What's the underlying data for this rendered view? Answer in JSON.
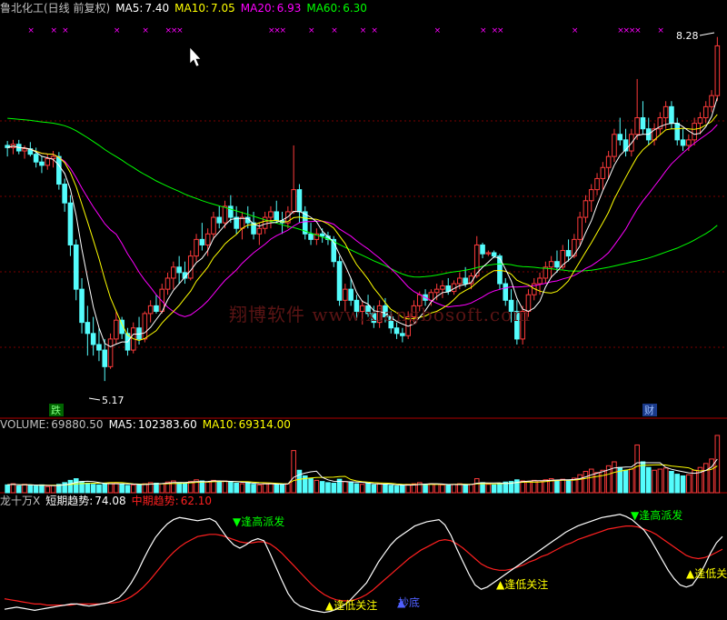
{
  "colors": {
    "up": "#ff3b3b",
    "down": "#54fcfc",
    "ma5": "#ffffff",
    "ma10": "#ffff00",
    "ma20": "#ff00ff",
    "ma60": "#00ff00",
    "grid": "#7a0000",
    "signal_x": "#ff00ff",
    "short_trend": "#ffffff",
    "mid_trend": "#ff2020",
    "label_yellow": "#ffff00",
    "label_green": "#00ff00",
    "label_blue": "#4040ff",
    "sell_box": "#00b000",
    "buy_box": "#3030d0"
  },
  "price_panel": {
    "title": "鲁北化工(日线 前复权)",
    "ma5_label": "MA5:",
    "ma5_value": "7.40",
    "ma10_label": "MA10:",
    "ma10_value": "7.05",
    "ma20_label": "MA20:",
    "ma20_value": "6.93",
    "ma60_label": "MA60:",
    "ma60_value": "6.30",
    "high_label": "8.28",
    "low_label": "5.17",
    "marker_die": "跌",
    "marker_cai": "财",
    "watermark": "翔博软件 www.xiangbosoft.com"
  },
  "volume_panel": {
    "title": "VOLUME:",
    "title_value": "69880.50",
    "ma5_label": "MA5:",
    "ma5_value": "102383.60",
    "ma10_label": "MA10:",
    "ma10_value": "69314.00"
  },
  "indicator_panel": {
    "title": "龙十万X",
    "short_label": "短期趋势:",
    "short_value": "74.08",
    "mid_label": "中期趋势:",
    "mid_value": "62.10",
    "sig_high1": "▼逢高派发",
    "sig_high2": "▼逢高派发",
    "sig_low1": "▲逢低关注",
    "sig_low2": "▲逢低关注",
    "sig_low3": "▲逢低关",
    "sig_buy": "抄底"
  },
  "chart_data": [
    {
      "type": "candlestick",
      "ylim": [
        4.9,
        8.45
      ],
      "candles_ohlc": [
        [
          7.3,
          7.34,
          7.2,
          7.28
        ],
        [
          7.28,
          7.35,
          7.22,
          7.31
        ],
        [
          7.31,
          7.35,
          7.22,
          7.25
        ],
        [
          7.25,
          7.3,
          7.18,
          7.27
        ],
        [
          7.27,
          7.33,
          7.2,
          7.22
        ],
        [
          7.22,
          7.28,
          7.1,
          7.15
        ],
        [
          7.15,
          7.2,
          7.05,
          7.12
        ],
        [
          7.12,
          7.22,
          7.08,
          7.18
        ],
        [
          7.18,
          7.25,
          7.1,
          7.2
        ],
        [
          7.2,
          7.24,
          6.9,
          6.95
        ],
        [
          6.95,
          7.0,
          6.7,
          6.78
        ],
        [
          6.78,
          6.85,
          6.3,
          6.4
        ],
        [
          6.4,
          6.45,
          5.9,
          6.0
        ],
        [
          6.0,
          6.1,
          5.6,
          5.7
        ],
        [
          5.7,
          5.85,
          5.4,
          5.6
        ],
        [
          5.6,
          5.75,
          5.4,
          5.5
        ],
        [
          5.5,
          5.65,
          5.35,
          5.45
        ],
        [
          5.45,
          5.55,
          5.17,
          5.3
        ],
        [
          5.3,
          5.6,
          5.28,
          5.55
        ],
        [
          5.55,
          5.8,
          5.5,
          5.72
        ],
        [
          5.72,
          5.75,
          5.55,
          5.6
        ],
        [
          5.6,
          5.65,
          5.4,
          5.45
        ],
        [
          5.45,
          5.7,
          5.42,
          5.65
        ],
        [
          5.65,
          5.75,
          5.5,
          5.55
        ],
        [
          5.55,
          5.8,
          5.52,
          5.78
        ],
        [
          5.78,
          5.9,
          5.7,
          5.85
        ],
        [
          5.85,
          5.95,
          5.78,
          5.8
        ],
        [
          5.8,
          6.05,
          5.78,
          6.0
        ],
        [
          6.0,
          6.15,
          5.95,
          6.1
        ],
        [
          6.1,
          6.25,
          6.0,
          6.2
        ],
        [
          6.2,
          6.3,
          6.05,
          6.15
        ],
        [
          6.15,
          6.25,
          6.05,
          6.1
        ],
        [
          6.1,
          6.35,
          6.08,
          6.3
        ],
        [
          6.3,
          6.5,
          6.25,
          6.45
        ],
        [
          6.45,
          6.6,
          6.35,
          6.4
        ],
        [
          6.4,
          6.55,
          6.3,
          6.5
        ],
        [
          6.5,
          6.7,
          6.45,
          6.65
        ],
        [
          6.65,
          6.75,
          6.55,
          6.6
        ],
        [
          6.6,
          6.8,
          6.55,
          6.75
        ],
        [
          6.75,
          6.85,
          6.6,
          6.65
        ],
        [
          6.65,
          6.75,
          6.5,
          6.55
        ],
        [
          6.55,
          6.7,
          6.45,
          6.65
        ],
        [
          6.65,
          6.75,
          6.55,
          6.6
        ],
        [
          6.6,
          6.7,
          6.45,
          6.5
        ],
        [
          6.5,
          6.6,
          6.4,
          6.55
        ],
        [
          6.55,
          6.7,
          6.5,
          6.65
        ],
        [
          6.65,
          6.75,
          6.55,
          6.7
        ],
        [
          6.7,
          6.8,
          6.6,
          6.62
        ],
        [
          6.62,
          6.7,
          6.5,
          6.6
        ],
        [
          6.6,
          6.75,
          6.55,
          6.7
        ],
        [
          6.7,
          7.3,
          6.68,
          6.9
        ],
        [
          6.9,
          6.95,
          6.6,
          6.7
        ],
        [
          6.7,
          6.75,
          6.45,
          6.5
        ],
        [
          6.5,
          6.6,
          6.4,
          6.45
        ],
        [
          6.45,
          6.55,
          6.4,
          6.5
        ],
        [
          6.5,
          6.55,
          6.42,
          6.48
        ],
        [
          6.48,
          6.52,
          6.4,
          6.45
        ],
        [
          6.45,
          6.48,
          6.2,
          6.25
        ],
        [
          6.25,
          6.3,
          5.85,
          5.9
        ],
        [
          5.9,
          6.05,
          5.8,
          6.0
        ],
        [
          6.0,
          6.1,
          5.85,
          5.9
        ],
        [
          5.9,
          5.95,
          5.72,
          5.8
        ],
        [
          5.8,
          5.9,
          5.68,
          5.85
        ],
        [
          5.85,
          5.95,
          5.75,
          5.78
        ],
        [
          5.78,
          5.85,
          5.65,
          5.7
        ],
        [
          5.7,
          5.9,
          5.65,
          5.85
        ],
        [
          5.85,
          5.92,
          5.7,
          5.75
        ],
        [
          5.75,
          5.8,
          5.6,
          5.65
        ],
        [
          5.65,
          5.7,
          5.55,
          5.6
        ],
        [
          5.6,
          5.65,
          5.52,
          5.58
        ],
        [
          5.58,
          5.8,
          5.55,
          5.75
        ],
        [
          5.75,
          5.9,
          5.7,
          5.85
        ],
        [
          5.85,
          5.98,
          5.8,
          5.95
        ],
        [
          5.95,
          6.0,
          5.85,
          5.9
        ],
        [
          5.9,
          6.0,
          5.85,
          5.97
        ],
        [
          5.97,
          6.05,
          5.9,
          6.0
        ],
        [
          6.0,
          6.08,
          5.92,
          6.03
        ],
        [
          6.03,
          6.1,
          5.95,
          5.98
        ],
        [
          5.98,
          6.08,
          5.95,
          6.05
        ],
        [
          6.05,
          6.15,
          6.0,
          6.1
        ],
        [
          6.1,
          6.2,
          6.02,
          6.05
        ],
        [
          6.05,
          6.15,
          6.0,
          6.12
        ],
        [
          6.12,
          6.48,
          6.1,
          6.4
        ],
        [
          6.4,
          6.42,
          6.28,
          6.32
        ],
        [
          6.32,
          6.35,
          6.3,
          6.33
        ],
        [
          6.33,
          6.35,
          6.28,
          6.3
        ],
        [
          6.3,
          6.32,
          6.0,
          6.05
        ],
        [
          6.05,
          6.1,
          5.85,
          5.9
        ],
        [
          5.9,
          6.0,
          5.7,
          5.8
        ],
        [
          5.8,
          5.9,
          5.5,
          5.55
        ],
        [
          5.55,
          5.85,
          5.5,
          5.8
        ],
        [
          5.8,
          6.0,
          5.75,
          5.95
        ],
        [
          5.95,
          6.1,
          5.9,
          6.05
        ],
        [
          6.05,
          6.15,
          5.95,
          6.1
        ],
        [
          6.1,
          6.25,
          6.05,
          6.2
        ],
        [
          6.2,
          6.3,
          6.1,
          6.25
        ],
        [
          6.25,
          6.35,
          6.15,
          6.2
        ],
        [
          6.2,
          6.4,
          6.18,
          6.35
        ],
        [
          6.35,
          6.45,
          6.25,
          6.3
        ],
        [
          6.3,
          6.5,
          6.28,
          6.45
        ],
        [
          6.45,
          6.7,
          6.4,
          6.65
        ],
        [
          6.65,
          6.85,
          6.6,
          6.8
        ],
        [
          6.8,
          6.95,
          6.7,
          6.9
        ],
        [
          6.9,
          7.05,
          6.85,
          7.0
        ],
        [
          7.0,
          7.15,
          6.9,
          7.1
        ],
        [
          7.1,
          7.25,
          7.0,
          7.2
        ],
        [
          7.2,
          7.45,
          7.15,
          7.4
        ],
        [
          7.4,
          7.55,
          7.3,
          7.35
        ],
        [
          7.35,
          7.45,
          7.2,
          7.25
        ],
        [
          7.25,
          7.45,
          7.2,
          7.4
        ],
        [
          7.4,
          7.9,
          7.35,
          7.55
        ],
        [
          7.55,
          7.7,
          7.4,
          7.45
        ],
        [
          7.45,
          7.55,
          7.3,
          7.35
        ],
        [
          7.35,
          7.5,
          7.3,
          7.45
        ],
        [
          7.45,
          7.6,
          7.4,
          7.55
        ],
        [
          7.55,
          7.7,
          7.45,
          7.65
        ],
        [
          7.65,
          7.7,
          7.45,
          7.5
        ],
        [
          7.5,
          7.55,
          7.3,
          7.35
        ],
        [
          7.35,
          7.45,
          7.25,
          7.3
        ],
        [
          7.3,
          7.4,
          7.25,
          7.35
        ],
        [
          7.35,
          7.55,
          7.3,
          7.5
        ],
        [
          7.5,
          7.6,
          7.4,
          7.55
        ],
        [
          7.55,
          7.7,
          7.5,
          7.65
        ],
        [
          7.65,
          7.8,
          7.6,
          7.75
        ],
        [
          7.75,
          8.28,
          7.7,
          8.2
        ]
      ],
      "ma_series": [
        "MA5",
        "MA10",
        "MA20",
        "MA60"
      ]
    },
    {
      "type": "bar",
      "title": "VOLUME",
      "ylim": [
        0,
        110000
      ],
      "values": [
        14000,
        16000,
        12000,
        15000,
        13000,
        12000,
        14000,
        11000,
        13000,
        15000,
        18000,
        22000,
        25000,
        20000,
        17000,
        15000,
        14000,
        16000,
        18000,
        17000,
        15000,
        13000,
        14000,
        15000,
        16000,
        18000,
        17000,
        16000,
        19000,
        21000,
        18000,
        17000,
        20000,
        23000,
        21000,
        19000,
        22000,
        20000,
        21000,
        19000,
        17000,
        16000,
        18000,
        15000,
        14000,
        16000,
        17000,
        15000,
        14000,
        16000,
        75000,
        40000,
        30000,
        25000,
        22000,
        20000,
        18000,
        17000,
        24000,
        20000,
        18000,
        16000,
        15000,
        17000,
        14000,
        16000,
        15000,
        13000,
        12000,
        13000,
        15000,
        16000,
        18000,
        15000,
        16000,
        15000,
        14000,
        13000,
        15000,
        16000,
        14000,
        15000,
        25000,
        18000,
        15000,
        14000,
        16000,
        19000,
        20000,
        23000,
        21000,
        20000,
        22000,
        21000,
        23000,
        25000,
        22000,
        24000,
        21000,
        26000,
        32000,
        38000,
        42000,
        36000,
        40000,
        48000,
        55000,
        45000,
        40000,
        42000,
        85000,
        55000,
        45000,
        40000,
        42000,
        44000,
        38000,
        33000,
        30000,
        32000,
        40000,
        45000,
        52000,
        60000,
        102000
      ],
      "ma_series": [
        "MA5",
        "MA10"
      ]
    },
    {
      "type": "line",
      "title": "龙十万X",
      "ylim": [
        0,
        100
      ],
      "series": [
        {
          "name": "短期趋势",
          "values": [
            5,
            6,
            7,
            6,
            5,
            4,
            5,
            6,
            7,
            8,
            9,
            10,
            10,
            9,
            8,
            9,
            10,
            11,
            13,
            16,
            22,
            30,
            40,
            52,
            63,
            73,
            80,
            86,
            90,
            92,
            91,
            90,
            89,
            90,
            91,
            88,
            80,
            72,
            66,
            63,
            66,
            70,
            72,
            70,
            58,
            45,
            32,
            20,
            12,
            8,
            6,
            4,
            3,
            2,
            3,
            5,
            8,
            12,
            18,
            24,
            30,
            40,
            50,
            58,
            66,
            72,
            76,
            80,
            84,
            86,
            88,
            89,
            90,
            85,
            75,
            62,
            50,
            38,
            28,
            24,
            26,
            30,
            34,
            38,
            42,
            46,
            50,
            54,
            58,
            62,
            66,
            70,
            74,
            78,
            81,
            84,
            86,
            88,
            90,
            92,
            93,
            94,
            95,
            93,
            90,
            85,
            80,
            72,
            62,
            52,
            42,
            34,
            28,
            26,
            28,
            36,
            46,
            58,
            68,
            74
          ]
        },
        {
          "name": "中期趋势",
          "values": [
            15,
            14,
            13,
            12,
            11,
            10,
            10,
            9,
            9,
            9,
            9,
            9,
            10,
            10,
            10,
            10,
            10,
            11,
            11,
            12,
            14,
            17,
            21,
            26,
            32,
            39,
            46,
            53,
            59,
            64,
            68,
            71,
            74,
            75,
            76,
            76,
            75,
            73,
            71,
            69,
            68,
            68,
            69,
            69,
            67,
            63,
            58,
            52,
            46,
            40,
            34,
            28,
            23,
            19,
            16,
            14,
            13,
            13,
            14,
            16,
            19,
            23,
            28,
            33,
            38,
            43,
            48,
            53,
            57,
            61,
            64,
            67,
            70,
            71,
            70,
            67,
            63,
            58,
            53,
            48,
            45,
            43,
            42,
            42,
            43,
            45,
            47,
            50,
            52,
            55,
            57,
            60,
            63,
            66,
            68,
            71,
            73,
            75,
            77,
            79,
            81,
            82,
            83,
            84,
            84,
            83,
            81,
            79,
            76,
            72,
            68,
            64,
            60,
            56,
            54,
            53,
            54,
            56,
            59,
            62
          ]
        }
      ]
    }
  ]
}
